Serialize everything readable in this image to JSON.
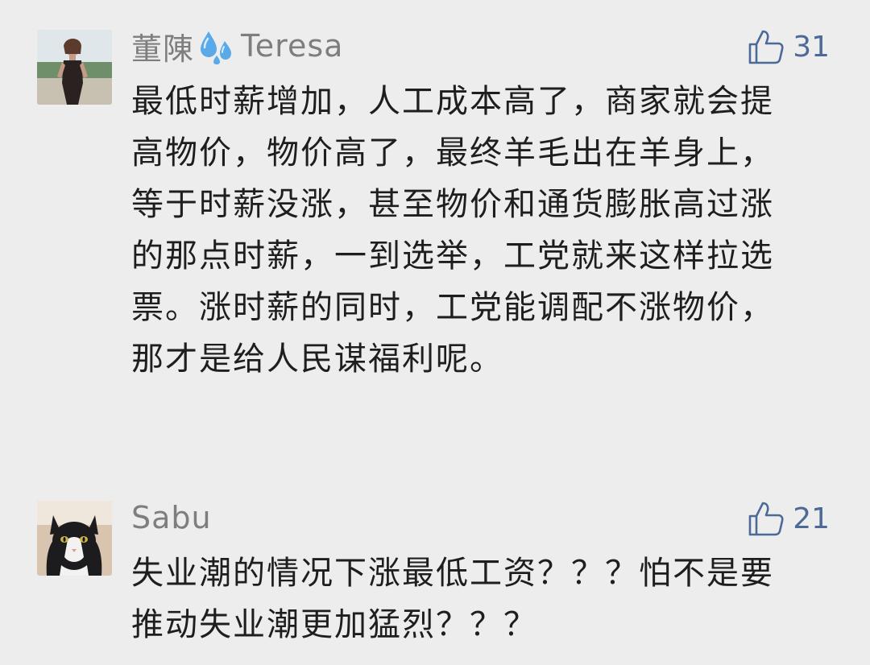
{
  "comments": [
    {
      "author_cn": "董陳",
      "author_icon": "sweat-droplets-icon",
      "author_en": "Teresa",
      "likes": "31",
      "text": "最低时薪增加，人工成本高了，商家就会提高物价，物价高了，最终羊毛出在羊身上，等于时薪没涨，甚至物价和通货膨胀高过涨的那点时薪，一到选举，工党就来这样拉选票。涨时薪的同时，工党能调配不涨物价，那才是给人民谋福利呢。"
    },
    {
      "author_en": "Sabu",
      "likes": "21",
      "text": "失业潮的情况下涨最低工资？？？怕不是要推动失业潮更加猛烈？？？"
    }
  ],
  "colors": {
    "background": "#ededed",
    "name": "#7e7e7e",
    "like": "#4d6a96",
    "text": "#1e1e1e",
    "droplet": "#5aa9e8"
  }
}
